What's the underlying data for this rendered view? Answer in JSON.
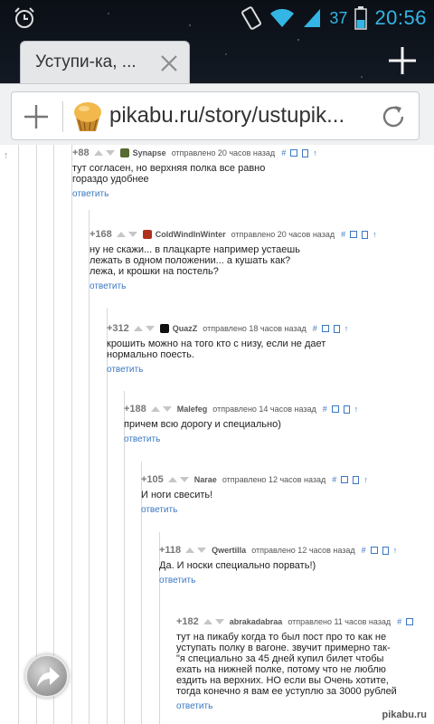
{
  "statusbar": {
    "battery": "37",
    "time": "20:56",
    "icons": [
      "alarm-icon",
      "rotation-icon",
      "wifi-icon",
      "signal-icon",
      "battery-icon"
    ]
  },
  "browser": {
    "tab_title": "Уступи-ка, ...",
    "url": "pikabu.ru/story/ustupik..."
  },
  "comments": [
    {
      "rating": "+88",
      "author": "Synapse",
      "posted": "отправлено 20 часов назад",
      "avatar_color": "#556b2f",
      "lines": [
        "тут согласен, но верхняя полка все равно",
        "гораздо удобнее"
      ],
      "reply": "ответить"
    },
    {
      "rating": "+168",
      "author": "ColdWindInWinter",
      "posted": "отправлено 20 часов назад",
      "avatar_color": "#b03020",
      "lines": [
        "ну не скажи... в плацкарте например устаешь",
        "лежать в одном положении... а кушать как?",
        "лежа, и крошки на постель?"
      ],
      "reply": "ответить"
    },
    {
      "rating": "+312",
      "author": "QuazZ",
      "posted": "отправлено 18 часов назад",
      "avatar_color": "#111111",
      "lines": [
        "крошить можно на того кто с низу, если не дает",
        "нормально поесть."
      ],
      "reply": "ответить"
    },
    {
      "rating": "+188",
      "author": "Malefeg",
      "posted": "отправлено 14 часов назад",
      "avatar_color": "",
      "lines": [
        "причем всю дорогу и специально)"
      ],
      "reply": "ответить"
    },
    {
      "rating": "+105",
      "author": "Narae",
      "posted": "отправлено 12 часов назад",
      "avatar_color": "",
      "lines": [
        "И ноги свесить!"
      ],
      "reply": "ответить"
    },
    {
      "rating": "+118",
      "author": "Qwertilla",
      "posted": "отправлено 12 часов назад",
      "avatar_color": "",
      "lines": [
        "Да. И носки специально порвать!)"
      ],
      "reply": "ответить"
    },
    {
      "rating": "+182",
      "author": "abrakadabraa",
      "posted": "отправлено 11 часов назад",
      "avatar_color": "",
      "lines": [
        "тут на пикабу когда то был пост про то как не",
        "уступать полку в вагоне. звучит примерно так-",
        "\"я специально за 45 дней купил билет чтобы",
        "ехать на нижней полке, потому что не люблю",
        "ездить на верхних. НО если вы Очень хотите,",
        "тогда конечно я вам ее уступлю за 3000 рублей"
      ],
      "reply": "ответить"
    }
  ],
  "tool_link": "#",
  "tool_arrow": "↑",
  "watermark": "pikabu.ru",
  "colors": {
    "accent": "#33b5e5",
    "link": "#3a78c2"
  }
}
